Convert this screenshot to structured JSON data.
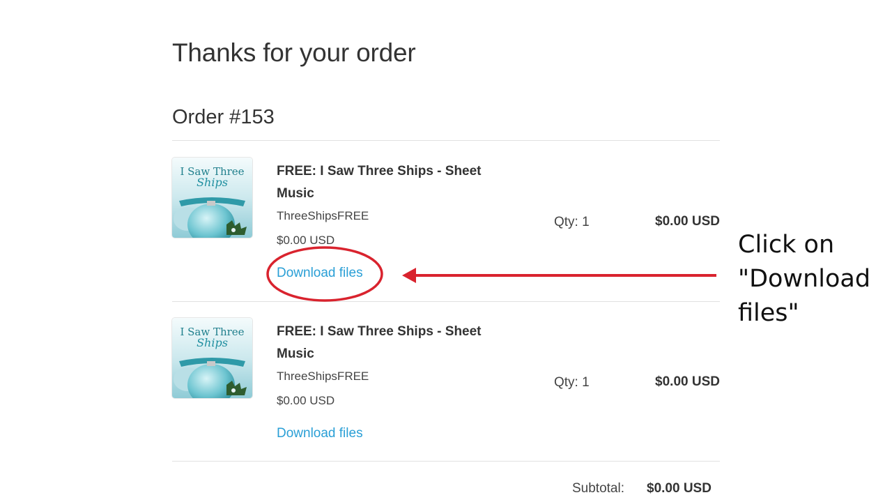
{
  "page": {
    "title": "Thanks for your order",
    "order_number": "Order #153"
  },
  "line_items": [
    {
      "thumbnail": {
        "line1": "I Saw Three",
        "line2": "Ships"
      },
      "title": "FREE: I Saw Three Ships - Sheet Music",
      "sku": "ThreeShipsFREE",
      "price": "$0.00 USD",
      "download_label": "Download files",
      "qty": "Qty: 1",
      "total": "$0.00 USD"
    },
    {
      "thumbnail": {
        "line1": "I Saw Three",
        "line2": "Ships"
      },
      "title": "FREE: I Saw Three Ships - Sheet Music",
      "sku": "ThreeShipsFREE",
      "price": "$0.00 USD",
      "download_label": "Download files",
      "qty": "Qty: 1",
      "total": "$0.00 USD"
    }
  ],
  "summary": {
    "subtotal_label": "Subtotal:",
    "subtotal_value": "$0.00 USD"
  },
  "annotation": {
    "text": "Click on \"Download files\"",
    "color": "#d9232e"
  },
  "colors": {
    "link": "#2a9fd6",
    "annotation_red": "#d9232e"
  }
}
